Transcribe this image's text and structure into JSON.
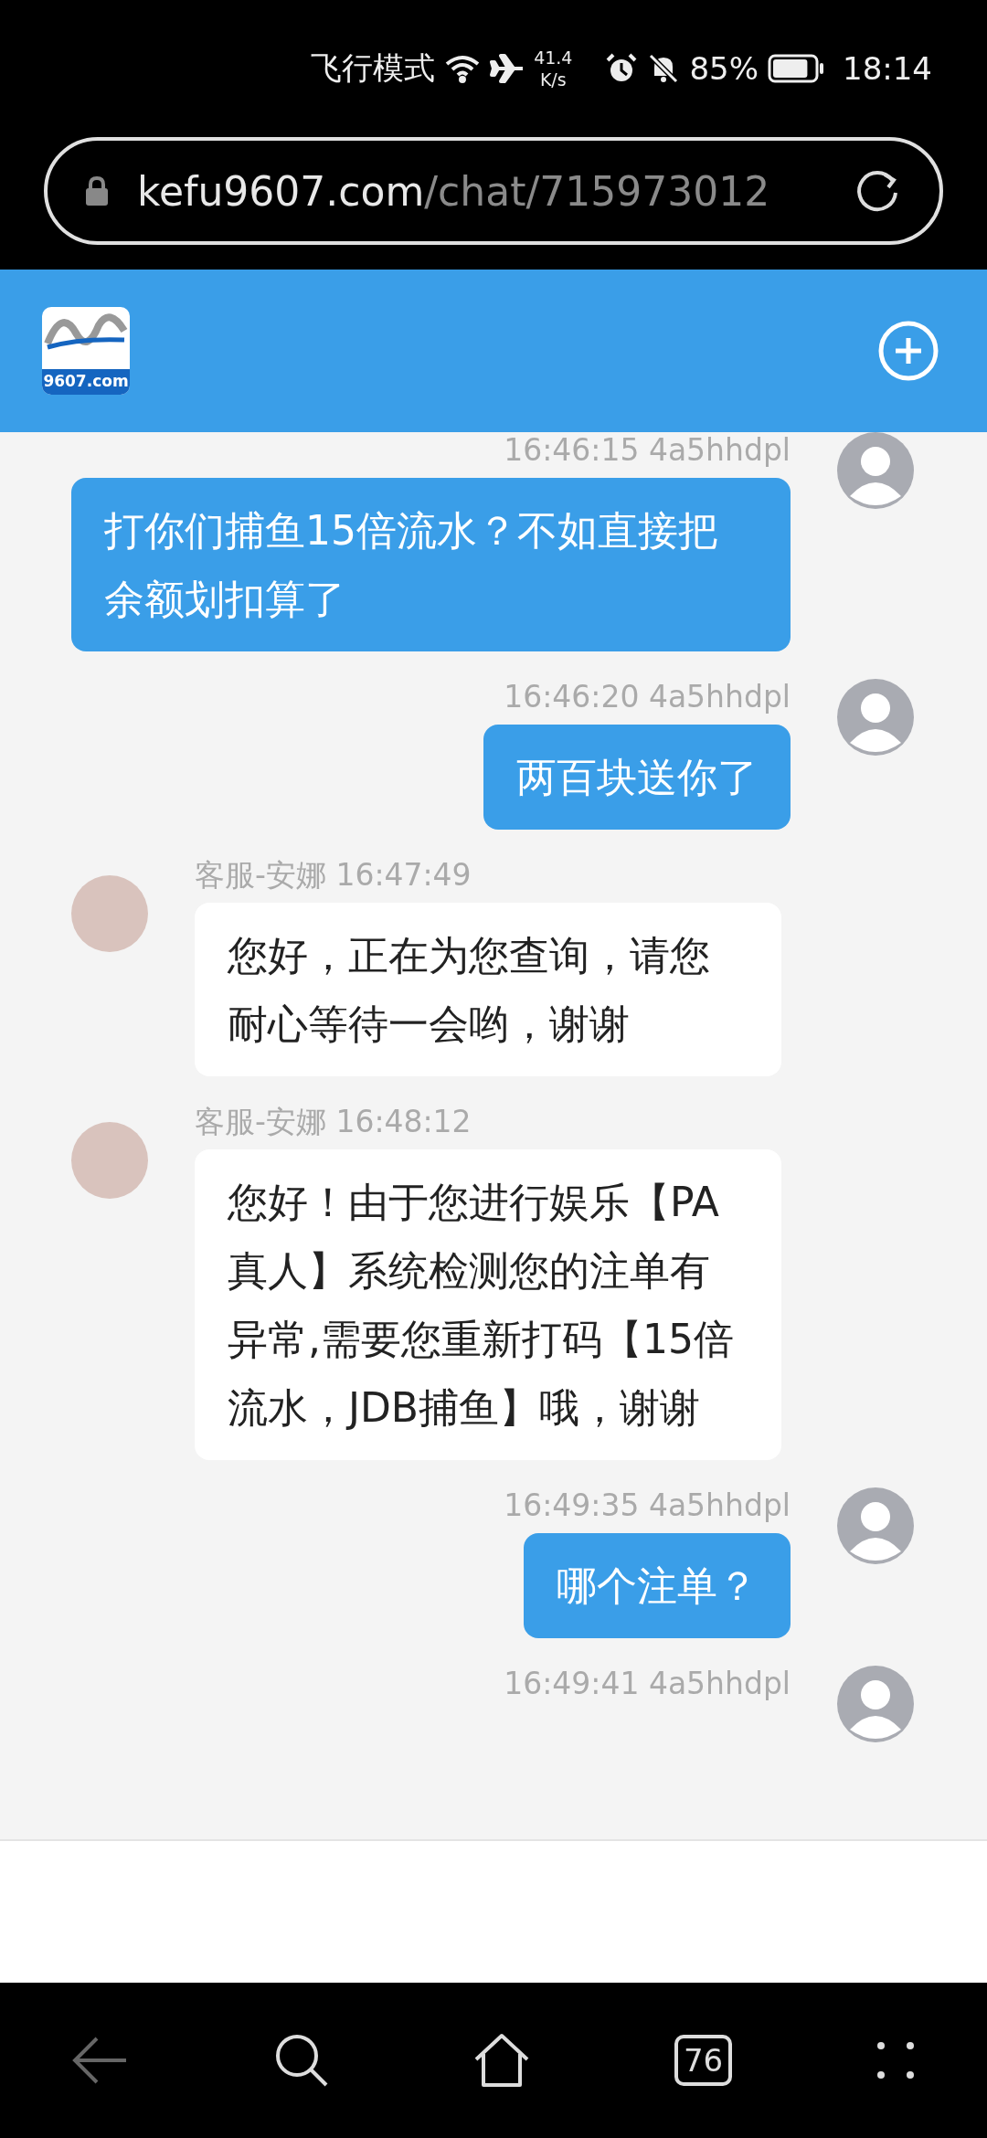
{
  "status_bar": {
    "mode": "飞行模式",
    "speed_value": "41.4",
    "speed_unit": "K/s",
    "battery": {
      "label": "85%",
      "level": 0.85
    },
    "time": "18:14"
  },
  "address_bar": {
    "domain": "kefu9607.com",
    "path": "/chat/715973012"
  },
  "header": {
    "logo_text": "9607.com"
  },
  "messages": [
    {
      "kind": "sent",
      "meta": "16:46:15 4a5hhdpl",
      "text": "打你们捕鱼15倍流水？不如直接把余额划扣算了"
    },
    {
      "kind": "sent",
      "meta": "16:46:20 4a5hhdpl",
      "text": "两百块送你了"
    },
    {
      "kind": "received",
      "meta": "客服-安娜 16:47:49",
      "text": "您好，正在为您查询，请您耐心等待一会哟，谢谢"
    },
    {
      "kind": "received",
      "meta": "客服-安娜 16:48:12",
      "text": "您好！由于您进行娱乐【PA真人】系统检测您的注单有异常,需要您重新打码【15倍流水，JDB捕鱼】哦，谢谢"
    },
    {
      "kind": "sent",
      "meta": "16:49:35 4a5hhdpl",
      "text": "哪个注单？"
    },
    {
      "kind": "sent",
      "meta": "16:49:41 4a5hhdpl"
    }
  ],
  "nav_bar": {
    "back_disabled": true,
    "tab_count": "76"
  }
}
